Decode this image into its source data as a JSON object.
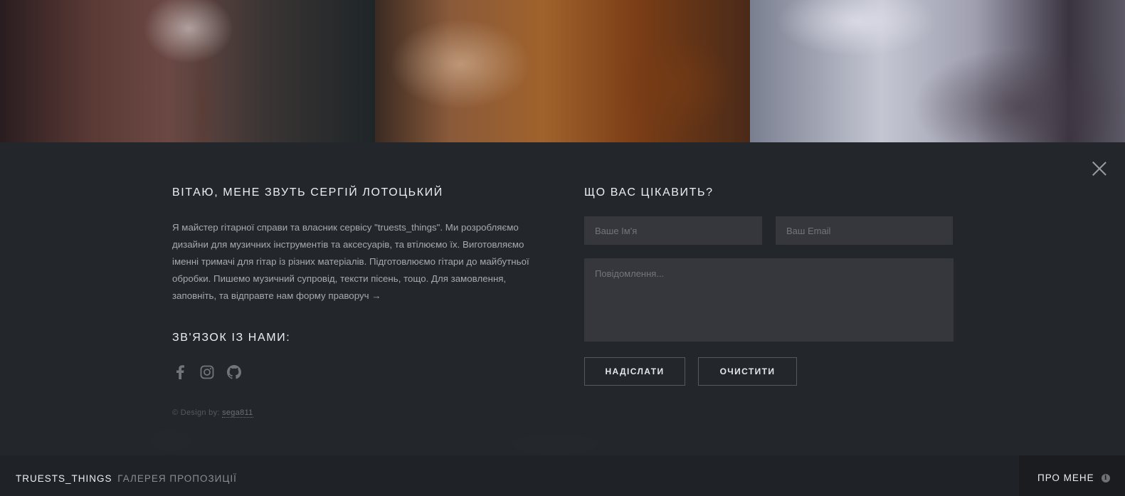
{
  "about": {
    "heading": "ВІТАЮ, МЕНЕ ЗВУТЬ СЕРГІЙ ЛОТОЦЬКИЙ",
    "intro": "Я майстер гітарної справи та власник сервісу \"truests_things\". Ми розробляємо дизайни для музичних інструментів та аксесуарів, та втілюємо їх. Виготовляємо іменні тримачі для гітар із різних матеріалів. Підготовлюємо гітари до майбутньої обробки. Пишемо музичний супровід, тексти пісень, тощо. Для замовлення, заповніть, та відправте нам форму праворуч →",
    "contact_heading": "ЗВ'ЯЗОК ІЗ НАМИ:",
    "socials": [
      "facebook-icon",
      "instagram-icon",
      "github-icon"
    ],
    "credit_prefix": "© Design by:",
    "credit_link": "sega811"
  },
  "form": {
    "heading": "ЩО ВАС ЦІКАВИТЬ?",
    "name_placeholder": "Ваше Ім'я",
    "email_placeholder": "Ваш Email",
    "message_placeholder": "Повідомлення...",
    "send_label": "НАДІСЛАТИ",
    "clear_label": "ОЧИСТИТИ"
  },
  "footer": {
    "brand": "TRUESTS_THINGS",
    "brand_sub": "ГАЛЕРЕЯ ПРОПОЗИЦІЇ",
    "about_label": "ПРО МЕНЕ",
    "about_icon": "info-icon"
  },
  "colors": {
    "panel": "#24272b",
    "footer": "#1f2226",
    "field": "#35373c",
    "text": "#eceef0",
    "muted": "#a7a9ad"
  }
}
